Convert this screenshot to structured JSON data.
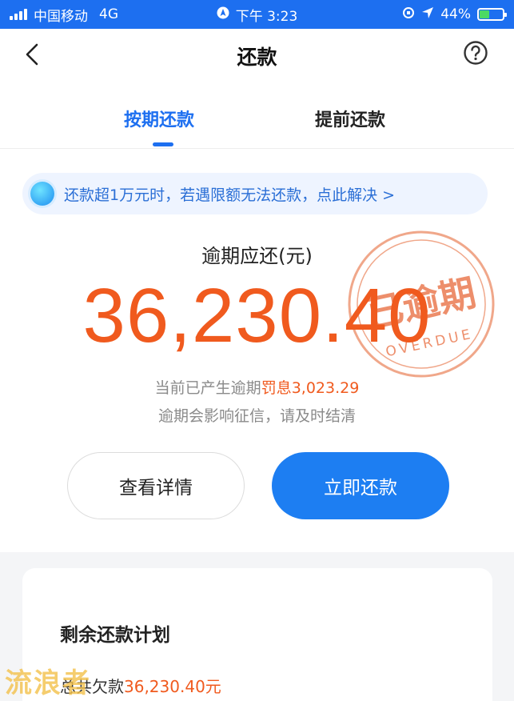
{
  "status_bar": {
    "carrier": "中国移动",
    "network": "4G",
    "time": "下午 3:23",
    "battery": "44%",
    "battery_level": 0.44
  },
  "nav": {
    "title": "还款",
    "back_icon": "chevron-left-icon",
    "help_icon": "question-circle-icon"
  },
  "tabs": [
    {
      "label": "按期还款",
      "active": true
    },
    {
      "label": "提前还款",
      "active": false
    }
  ],
  "notice": {
    "text": "还款超1万元时，若遇限额无法还款，点此解决 >"
  },
  "stamp": {
    "text": "已逾期",
    "subtext": "OVERDUE"
  },
  "overdue": {
    "label": "逾期应还(元)",
    "amount": "36,230.40",
    "note_prefix": "当前已产生逾期",
    "penalty": "罚息3,023.29",
    "note2": "逾期会影响征信，请及时结清"
  },
  "buttons": {
    "details": "查看详情",
    "pay": "立即还款"
  },
  "plan": {
    "title": "剩余还款计划",
    "owe_prefix": "总共欠款",
    "owe_amount": "36,230.40元"
  },
  "watermark": "流浪者",
  "colors": {
    "brand_blue": "#1d6ff0",
    "overdue_orange": "#f05a1e",
    "stamp_red": "#e8693a"
  }
}
